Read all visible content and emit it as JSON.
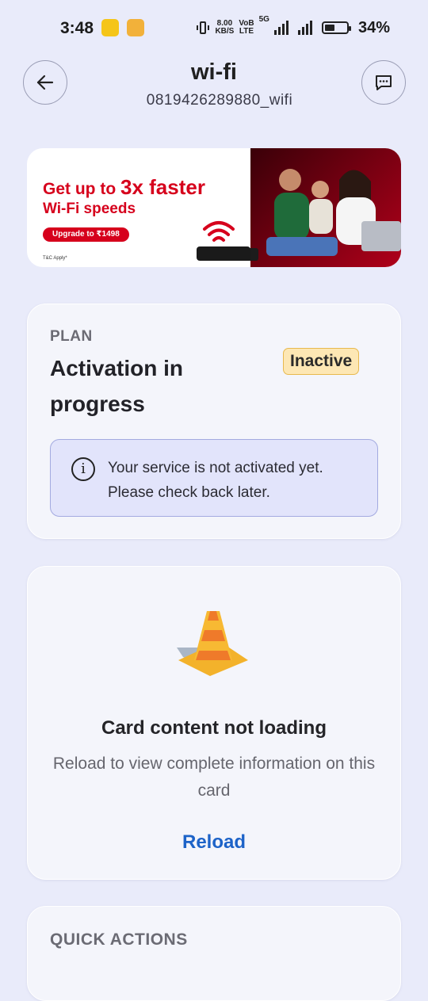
{
  "status_bar": {
    "time": "3:48",
    "speed_value": "8.00",
    "speed_unit": "KB/S",
    "volte_top": "VoB",
    "volte_bottom": "LTE",
    "network": "5G",
    "battery": "34%"
  },
  "header": {
    "title": "wi-fi",
    "subtitle": "0819426289880_wifi",
    "back_icon": "arrow-left-icon",
    "chat_icon": "chat-bubble-icon"
  },
  "banner": {
    "line1_prefix": "Get up to ",
    "line1_highlight": "3x faster",
    "line2": "Wi-Fi speeds",
    "cta": "Upgrade to ₹1498",
    "tc": "T&C Apply*",
    "accent_color": "#d6001c"
  },
  "plan": {
    "label": "PLAN",
    "title": "Activation in progress",
    "badge": "Inactive",
    "info_icon": "info-icon",
    "info_text": "Your service is not activated yet. Please check back later."
  },
  "error_card": {
    "icon": "traffic-cone-icon",
    "title": "Card content not loading",
    "subtitle": "Reload to view complete information on this card",
    "action": "Reload",
    "action_color": "#1d63c8"
  },
  "quick_actions": {
    "label": "QUICK ACTIONS"
  }
}
